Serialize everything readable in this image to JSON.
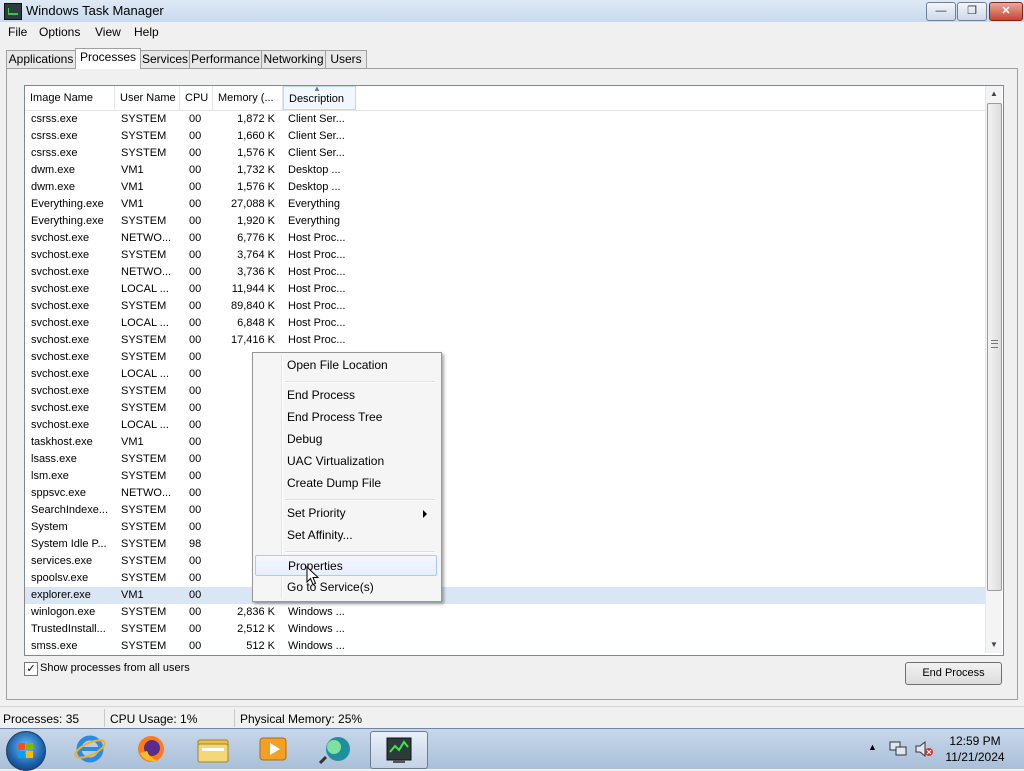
{
  "window": {
    "title": "Windows Task Manager",
    "minimize": "—",
    "maximize": "❐",
    "close": "✕"
  },
  "menu": [
    "File",
    "Options",
    "View",
    "Help"
  ],
  "tabs": [
    "Applications",
    "Processes",
    "Services",
    "Performance",
    "Networking",
    "Users"
  ],
  "active_tab": "Processes",
  "columns": [
    "Image Name",
    "User Name",
    "CPU",
    "Memory (...",
    "Description"
  ],
  "processes": [
    {
      "name": "csrss.exe",
      "user": "SYSTEM",
      "cpu": "00",
      "mem": "1,872 K",
      "desc": "Client Ser..."
    },
    {
      "name": "csrss.exe",
      "user": "SYSTEM",
      "cpu": "00",
      "mem": "1,660 K",
      "desc": "Client Ser..."
    },
    {
      "name": "csrss.exe",
      "user": "SYSTEM",
      "cpu": "00",
      "mem": "1,576 K",
      "desc": "Client Ser..."
    },
    {
      "name": "dwm.exe",
      "user": "VM1",
      "cpu": "00",
      "mem": "1,732 K",
      "desc": "Desktop ..."
    },
    {
      "name": "dwm.exe",
      "user": "VM1",
      "cpu": "00",
      "mem": "1,576 K",
      "desc": "Desktop ..."
    },
    {
      "name": "Everything.exe",
      "user": "VM1",
      "cpu": "00",
      "mem": "27,088 K",
      "desc": "Everything"
    },
    {
      "name": "Everything.exe",
      "user": "SYSTEM",
      "cpu": "00",
      "mem": "1,920 K",
      "desc": "Everything"
    },
    {
      "name": "svchost.exe",
      "user": "NETWO...",
      "cpu": "00",
      "mem": "6,776 K",
      "desc": "Host Proc..."
    },
    {
      "name": "svchost.exe",
      "user": "SYSTEM",
      "cpu": "00",
      "mem": "3,764 K",
      "desc": "Host Proc..."
    },
    {
      "name": "svchost.exe",
      "user": "NETWO...",
      "cpu": "00",
      "mem": "3,736 K",
      "desc": "Host Proc..."
    },
    {
      "name": "svchost.exe",
      "user": "LOCAL ...",
      "cpu": "00",
      "mem": "11,944 K",
      "desc": "Host Proc..."
    },
    {
      "name": "svchost.exe",
      "user": "SYSTEM",
      "cpu": "00",
      "mem": "89,840 K",
      "desc": "Host Proc..."
    },
    {
      "name": "svchost.exe",
      "user": "LOCAL ...",
      "cpu": "00",
      "mem": "6,848 K",
      "desc": "Host Proc..."
    },
    {
      "name": "svchost.exe",
      "user": "SYSTEM",
      "cpu": "00",
      "mem": "17,416 K",
      "desc": "Host Proc..."
    },
    {
      "name": "svchost.exe",
      "user": "SYSTEM",
      "cpu": "00",
      "mem": "3,0",
      "desc": ""
    },
    {
      "name": "svchost.exe",
      "user": "LOCAL ...",
      "cpu": "00",
      "mem": "7,8",
      "desc": ""
    },
    {
      "name": "svchost.exe",
      "user": "SYSTEM",
      "cpu": "00",
      "mem": "57,6",
      "desc": ""
    },
    {
      "name": "svchost.exe",
      "user": "SYSTEM",
      "cpu": "00",
      "mem": "2,9",
      "desc": ""
    },
    {
      "name": "svchost.exe",
      "user": "LOCAL ...",
      "cpu": "00",
      "mem": "1,6",
      "desc": ""
    },
    {
      "name": "taskhost.exe",
      "user": "VM1",
      "cpu": "00",
      "mem": "2,4",
      "desc": ""
    },
    {
      "name": "lsass.exe",
      "user": "SYSTEM",
      "cpu": "00",
      "mem": "4,3",
      "desc": ""
    },
    {
      "name": "lsm.exe",
      "user": "SYSTEM",
      "cpu": "00",
      "mem": "1,8",
      "desc": ""
    },
    {
      "name": "sppsvc.exe",
      "user": "NETWO...",
      "cpu": "00",
      "mem": "13,1",
      "desc": ""
    },
    {
      "name": "SearchIndexe...",
      "user": "SYSTEM",
      "cpu": "00",
      "mem": "6,9",
      "desc": ""
    },
    {
      "name": "System",
      "user": "SYSTEM",
      "cpu": "00",
      "mem": "",
      "desc": ""
    },
    {
      "name": "System Idle P...",
      "user": "SYSTEM",
      "cpu": "98",
      "mem": "",
      "desc": ""
    },
    {
      "name": "services.exe",
      "user": "SYSTEM",
      "cpu": "00",
      "mem": "4,5",
      "desc": ""
    },
    {
      "name": "spoolsv.exe",
      "user": "SYSTEM",
      "cpu": "00",
      "mem": "4,6",
      "desc": ""
    },
    {
      "name": "explorer.exe",
      "user": "VM1",
      "cpu": "00",
      "mem": "11,3",
      "desc": ""
    },
    {
      "name": "winlogon.exe",
      "user": "SYSTEM",
      "cpu": "00",
      "mem": "2,836 K",
      "desc": "Windows ..."
    },
    {
      "name": "TrustedInstall...",
      "user": "SYSTEM",
      "cpu": "00",
      "mem": "2,512 K",
      "desc": "Windows ..."
    },
    {
      "name": "smss.exe",
      "user": "SYSTEM",
      "cpu": "00",
      "mem": "512 K",
      "desc": "Windows ..."
    }
  ],
  "selected_process": "explorer.exe",
  "show_all_users": {
    "label": "Show processes from all users",
    "checked": "✓"
  },
  "end_process_button": "End Process",
  "context_menu": [
    {
      "label": "Open File Location"
    },
    {
      "label": "End Process"
    },
    {
      "label": "End Process Tree"
    },
    {
      "label": "Debug"
    },
    {
      "label": "UAC Virtualization"
    },
    {
      "label": "Create Dump File"
    },
    {
      "label": "Set Priority"
    },
    {
      "label": "Set Affinity..."
    },
    {
      "label": "Properties"
    },
    {
      "label": "Go to Service(s)"
    }
  ],
  "context_menu_highlighted": "Properties",
  "status": {
    "processes": "Processes: 35",
    "cpu": "CPU Usage: 1%",
    "memory": "Physical Memory: 25%"
  },
  "taskbar": {
    "items": [
      "start-button",
      "internet-explorer",
      "firefox",
      "windows-explorer",
      "media-player",
      "network-app",
      "task-manager"
    ],
    "time": "12:59 PM",
    "date": "11/21/2024"
  },
  "colors": {
    "selection": "#dbe6f4",
    "menu_highlight": "#e6eefb",
    "taskbar": "#b8cbe2"
  }
}
